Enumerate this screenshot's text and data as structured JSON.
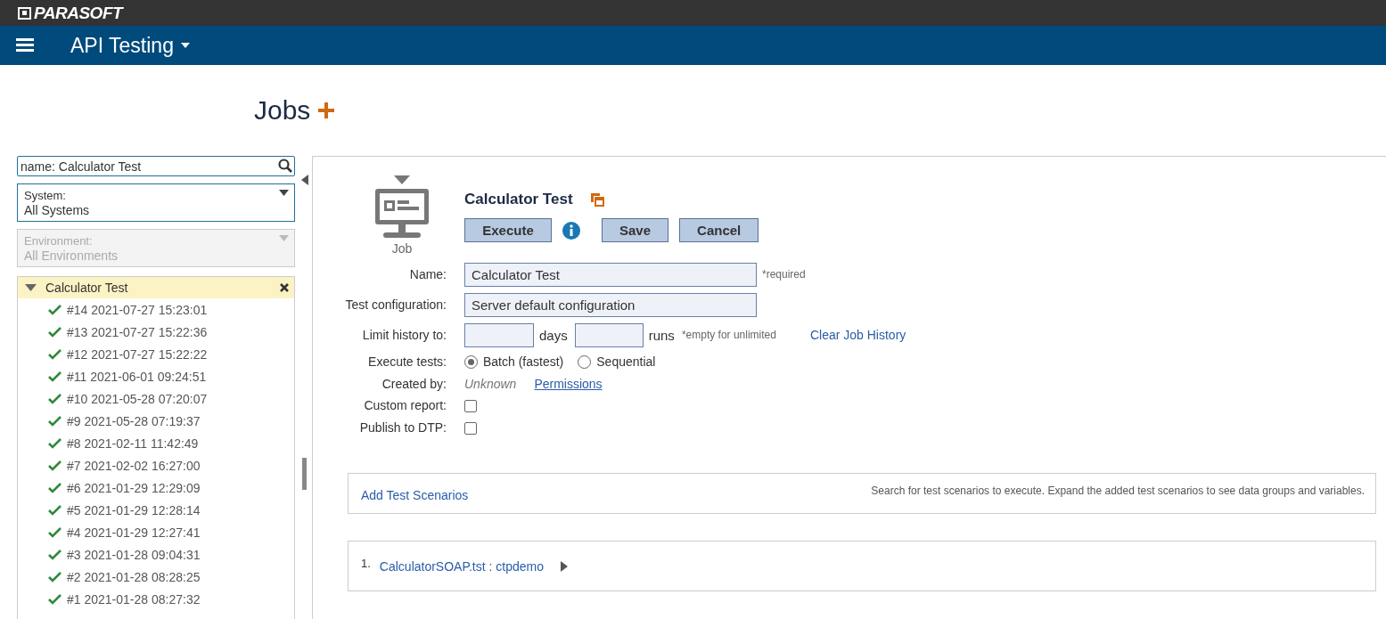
{
  "header": {
    "brand": "PARASOFT"
  },
  "nav": {
    "title": "API Testing"
  },
  "page": {
    "title": "Jobs"
  },
  "sidebar": {
    "search": {
      "value": "name: Calculator Test"
    },
    "system": {
      "label": "System:",
      "value": "All Systems",
      "disabled": false
    },
    "environment": {
      "label": "Environment:",
      "value": "All Environments",
      "disabled": true
    },
    "tree": {
      "label": "Calculator Test",
      "expanded": true,
      "selected": true,
      "children": [
        {
          "label": "#14 2021-07-27 15:23:01",
          "kind": "passed"
        },
        {
          "label": "#13 2021-07-27 15:22:36",
          "kind": "passed"
        },
        {
          "label": "#12 2021-07-27 15:22:22",
          "kind": "passed"
        },
        {
          "label": "#11 2021-06-01 09:24:51",
          "kind": "passed"
        },
        {
          "label": "#10 2021-05-28 07:20:07",
          "kind": "passed"
        },
        {
          "label": "#9 2021-05-28 07:19:37",
          "kind": "passed"
        },
        {
          "label": "#8 2021-02-11 11:42:49",
          "kind": "passed"
        },
        {
          "label": "#7 2021-02-02 16:27:00",
          "kind": "passed"
        },
        {
          "label": "#6 2021-01-29 12:29:09",
          "kind": "passed"
        },
        {
          "label": "#5 2021-01-29 12:28:14",
          "kind": "passed"
        },
        {
          "label": "#4 2021-01-29 12:27:41",
          "kind": "passed"
        },
        {
          "label": "#3 2021-01-28 09:04:31",
          "kind": "passed"
        },
        {
          "label": "#2 2021-01-28 08:28:25",
          "kind": "passed"
        },
        {
          "label": "#1 2021-01-28 08:27:32",
          "kind": "passed"
        }
      ]
    }
  },
  "job": {
    "icon_label": "Job",
    "title": "Calculator Test",
    "toolbar": [
      {
        "kind": "button",
        "label": "Execute"
      },
      {
        "kind": "info"
      },
      {
        "kind": "button",
        "label": "Save"
      },
      {
        "kind": "button",
        "label": "Cancel"
      }
    ],
    "name": {
      "label": "Name:",
      "value": "Calculator Test",
      "note": "*required"
    },
    "test_configuration": {
      "label": "Test configuration:",
      "value": "Server default configuration"
    },
    "limit_history": {
      "label": "Limit history to:",
      "days_unit": "days",
      "runs_unit": "runs",
      "note": "*empty for unlimited",
      "link": "Clear Job History"
    },
    "execute_tests": {
      "label": "Execute tests:",
      "options": [
        {
          "label": "Batch (fastest)",
          "selected": true
        },
        {
          "label": "Sequential",
          "selected": false
        }
      ]
    },
    "created_by": {
      "label": "Created by:",
      "value": "Unknown",
      "link": "Permissions"
    },
    "custom_report": {
      "label": "Custom report:",
      "checked": false
    },
    "publish_to_dtp": {
      "label": "Publish to DTP:",
      "checked": false
    }
  },
  "scenarios": {
    "add_link": "Add Test Scenarios",
    "hint": "Search for test scenarios to execute. Expand the added test scenarios to see data groups and variables.",
    "items": [
      {
        "number": "1.",
        "name": "CalculatorSOAP.tst : ctpdemo",
        "expanded": false
      }
    ]
  }
}
